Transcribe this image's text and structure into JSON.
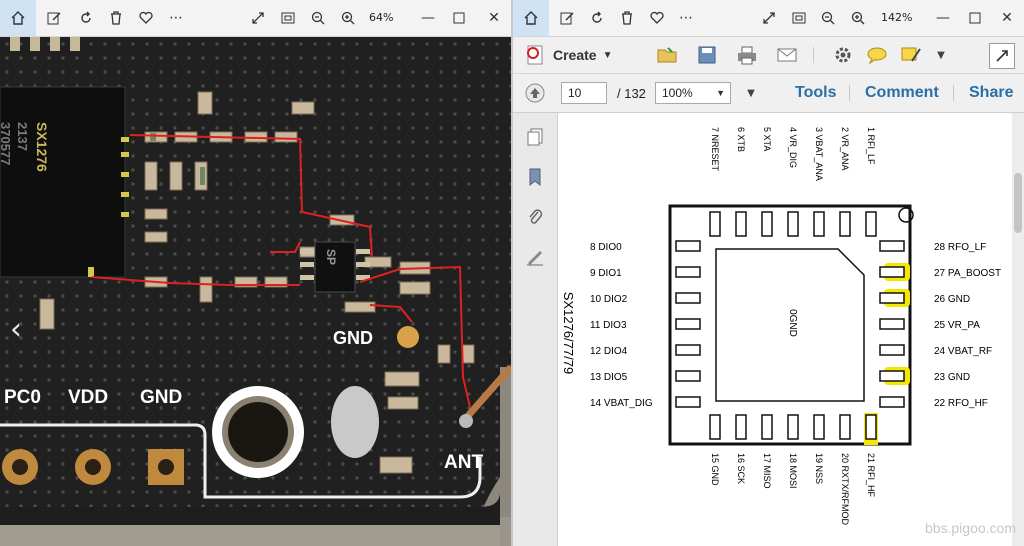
{
  "left_viewer": {
    "zoom": "64%",
    "board_labels": {
      "chip_brand": "SX1276",
      "chip_line2": "2137",
      "chip_line3": "370577",
      "small_chip": "SP",
      "gnd_pad": "GND",
      "bottom_labels": [
        "PC0",
        "VDD",
        "GND"
      ],
      "antenna": "ANT"
    }
  },
  "right_viewer": {
    "zoom": "142%",
    "acrobat": {
      "create_label": "Create",
      "page_current": "10",
      "page_total": "/ 132",
      "zoom_value": "100%",
      "tools_label": "Tools",
      "comment_label": "Comment",
      "share_label": "Share"
    },
    "diagram": {
      "part_label": "SX1276/77/79",
      "center_label": "0GND",
      "top_pins": [
        "7 NRESET",
        "6 XTB",
        "5 XTA",
        "4 VR_DIG",
        "3 VBAT_ANA",
        "2 VR_ANA",
        "1 RFI_LF"
      ],
      "left_pins": [
        "8 DIO0",
        "9 DIO1",
        "10 DIO2",
        "11 DIO3",
        "12 DIO4",
        "13 DIO5",
        "14 VBAT_DIG"
      ],
      "right_pins": [
        "28 RFO_LF",
        "27 PA_BOOST",
        "26 GND",
        "25 VR_PA",
        "24 VBAT_RF",
        "23 GND",
        "22 RFO_HF"
      ],
      "bottom_pins": [
        "15 GND",
        "16 SCK",
        "17 MISO",
        "18 MOSI",
        "19 NSS",
        "20 RXTX/RFMOD",
        "21 RFI_HF"
      ]
    },
    "highlight_color": "#f5e800"
  },
  "watermark": "bbs.pigoo.com"
}
